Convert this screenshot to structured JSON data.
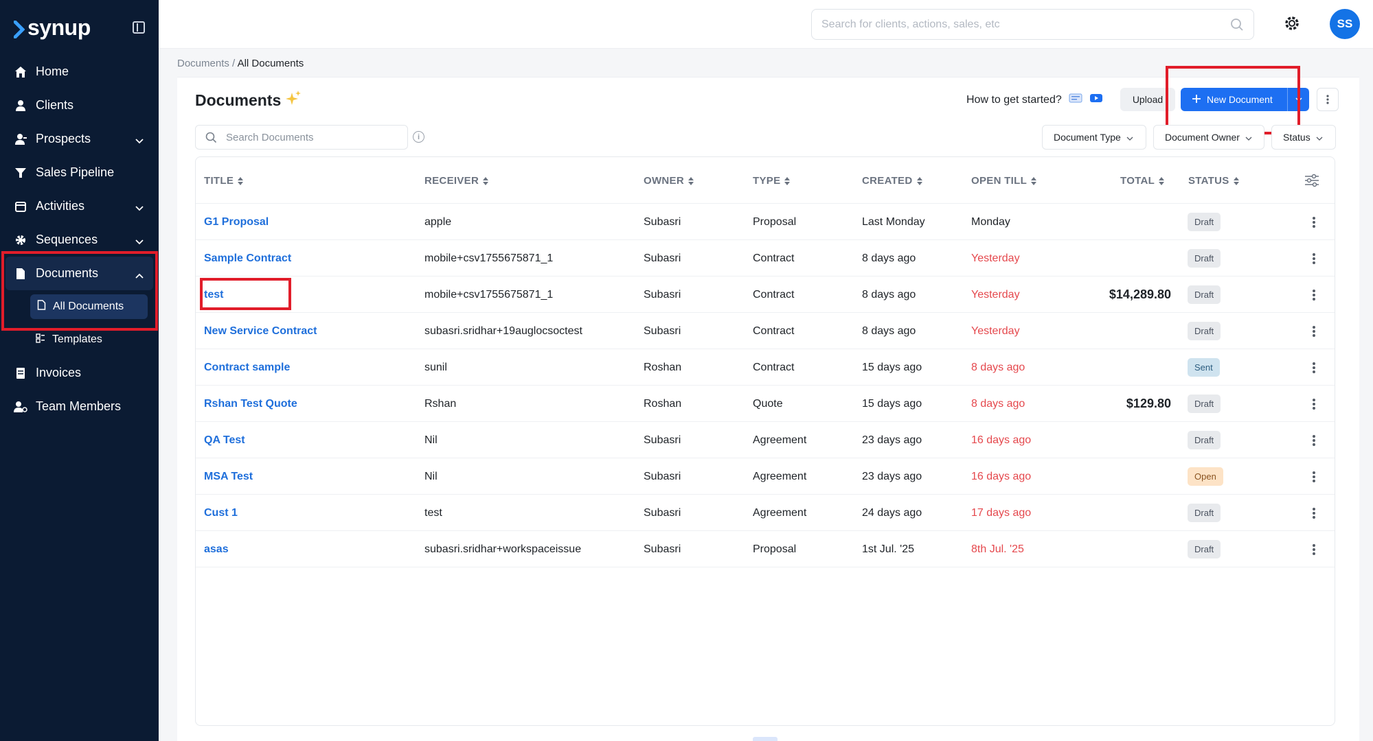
{
  "brand": {
    "name": "synup"
  },
  "sidebar": {
    "items": [
      {
        "label": "Home",
        "icon": "home-icon"
      },
      {
        "label": "Clients",
        "icon": "user-icon"
      },
      {
        "label": "Prospects",
        "icon": "user-plus-icon"
      },
      {
        "label": "Sales Pipeline",
        "icon": "funnel-icon"
      },
      {
        "label": "Activities",
        "icon": "calendar-icon"
      },
      {
        "label": "Sequences",
        "icon": "gear-icon"
      },
      {
        "label": "Documents",
        "icon": "document-icon"
      },
      {
        "label": "Invoices",
        "icon": "invoice-icon"
      },
      {
        "label": "Team Members",
        "icon": "team-icon"
      }
    ],
    "documents_sub": [
      {
        "label": "All Documents"
      },
      {
        "label": "Templates"
      }
    ]
  },
  "topbar": {
    "search_placeholder": "Search for clients, actions, sales, etc",
    "avatar_initials": "SS"
  },
  "breadcrumb": {
    "parent": "Documents",
    "separator": " / ",
    "current": "All Documents"
  },
  "page": {
    "title": "Documents",
    "how_to": "How to get started?",
    "upload_label": "Upload",
    "new_document_label": "New Document",
    "search_placeholder": "Search Documents",
    "filters": [
      "Document Type",
      "Document Owner",
      "Status"
    ]
  },
  "table": {
    "columns": [
      "TITLE",
      "RECEIVER",
      "OWNER",
      "TYPE",
      "CREATED",
      "OPEN TILL",
      "TOTAL",
      "STATUS"
    ],
    "rows": [
      {
        "title": "G1 Proposal",
        "receiver": "apple",
        "owner": "Subasri",
        "type": "Proposal",
        "created": "Last Monday",
        "open_till": "Monday",
        "overdue": false,
        "total": "",
        "status": "Draft"
      },
      {
        "title": "Sample Contract",
        "receiver": "mobile+csv1755675871_1",
        "owner": "Subasri",
        "type": "Contract",
        "created": "8 days ago",
        "open_till": "Yesterday",
        "overdue": true,
        "total": "",
        "status": "Draft"
      },
      {
        "title": "test",
        "receiver": "mobile+csv1755675871_1",
        "owner": "Subasri",
        "type": "Contract",
        "created": "8 days ago",
        "open_till": "Yesterday",
        "overdue": true,
        "total": "$14,289.80",
        "status": "Draft"
      },
      {
        "title": "New Service Contract",
        "receiver": "subasri.sridhar+19auglocsoctest",
        "owner": "Subasri",
        "type": "Contract",
        "created": "8 days ago",
        "open_till": "Yesterday",
        "overdue": true,
        "total": "",
        "status": "Draft"
      },
      {
        "title": "Contract sample",
        "receiver": "sunil",
        "owner": "Roshan",
        "type": "Contract",
        "created": "15 days ago",
        "open_till": "8 days ago",
        "overdue": true,
        "total": "",
        "status": "Sent"
      },
      {
        "title": "Rshan Test Quote",
        "receiver": "Rshan",
        "owner": "Roshan",
        "type": "Quote",
        "created": "15 days ago",
        "open_till": "8 days ago",
        "overdue": true,
        "total": "$129.80",
        "status": "Draft"
      },
      {
        "title": "QA Test",
        "receiver": "Nil",
        "owner": "Subasri",
        "type": "Agreement",
        "created": "23 days ago",
        "open_till": "16 days ago",
        "overdue": true,
        "total": "",
        "status": "Draft"
      },
      {
        "title": "MSA Test",
        "receiver": "Nil",
        "owner": "Subasri",
        "type": "Agreement",
        "created": "23 days ago",
        "open_till": "16 days ago",
        "overdue": true,
        "total": "",
        "status": "Open"
      },
      {
        "title": "Cust 1",
        "receiver": "test",
        "owner": "Subasri",
        "type": "Agreement",
        "created": "24 days ago",
        "open_till": "17 days ago",
        "overdue": true,
        "total": "",
        "status": "Draft"
      },
      {
        "title": "asas",
        "receiver": "subasri.sridhar+workspaceissue",
        "owner": "Subasri",
        "type": "Proposal",
        "created": "1st Jul. '25",
        "open_till": "8th Jul. '25",
        "overdue": true,
        "total": "",
        "status": "Draft"
      }
    ]
  },
  "colors": {
    "sidebar_bg": "#0b1b33",
    "accent": "#1d6ff2",
    "link": "#1f6fdb",
    "overdue": "#e5484d",
    "highlight_box": "#e11d2a"
  }
}
